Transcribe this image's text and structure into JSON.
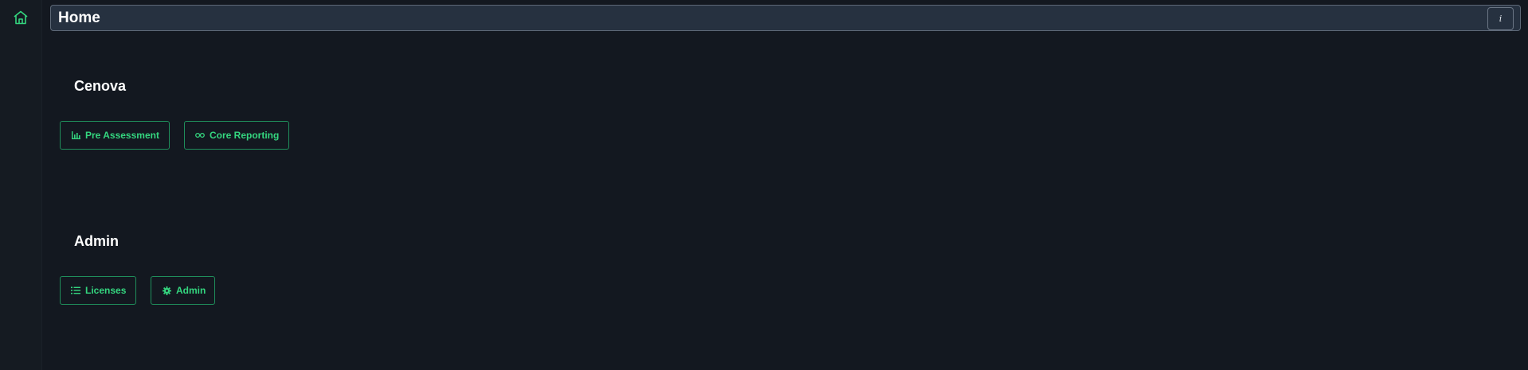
{
  "header": {
    "title": "Home",
    "info_label": "i"
  },
  "sidebar": {
    "home_icon": "home-icon"
  },
  "sections": [
    {
      "title": "Cenova",
      "buttons": [
        {
          "label": "Pre Assessment",
          "icon": "bar-chart-icon"
        },
        {
          "label": "Core Reporting",
          "icon": "infinity-icon"
        }
      ]
    },
    {
      "title": "Admin",
      "buttons": [
        {
          "label": "Licenses",
          "icon": "list-icon"
        },
        {
          "label": "Admin",
          "icon": "gear-icon"
        }
      ]
    }
  ],
  "colors": {
    "background": "#131820",
    "header_bg": "#263140",
    "accent": "#34d67f",
    "button_border": "#1f8e5b"
  }
}
